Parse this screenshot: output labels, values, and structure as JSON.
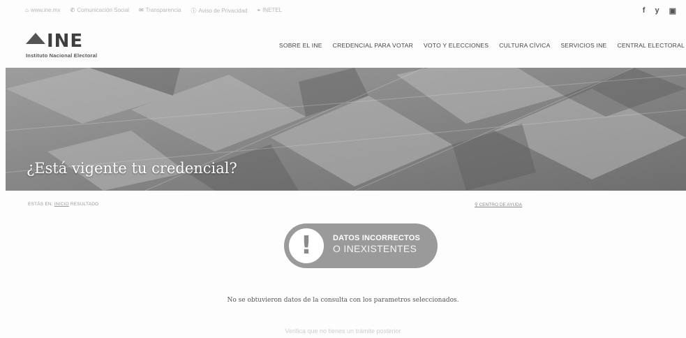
{
  "topbar": {
    "items": [
      {
        "icon": "home-icon",
        "label": "www.ine.mx"
      },
      {
        "icon": "phone-icon",
        "label": "Comunicación Social"
      },
      {
        "icon": "mail-icon",
        "label": "Transparencia"
      },
      {
        "icon": "info-icon",
        "label": "Aviso de Privacidad"
      },
      {
        "icon": "map-icon",
        "label": "INETEL"
      }
    ],
    "social": [
      {
        "icon": "facebook-icon",
        "glyph": "f"
      },
      {
        "icon": "twitter-icon",
        "glyph": "y"
      },
      {
        "icon": "youtube-icon",
        "glyph": "▫"
      }
    ]
  },
  "logo": {
    "mark": "INE",
    "subtitle": "Instituto Nacional Electoral"
  },
  "nav": [
    "SOBRE EL INE",
    "CREDENCIAL PARA VOTAR",
    "VOTO Y ELECCIONES",
    "CULTURA CÍVICA",
    "SERVICIOS INE",
    "CENTRAL ELECTORAL"
  ],
  "hero": {
    "title": "¿Está vigente tu credencial?"
  },
  "breadcrumb": {
    "items": [
      "ESTÁS EN:",
      "INICIO",
      "RESULTADO"
    ]
  },
  "help_link": "CENTRO DE AYUDA",
  "alert": {
    "line1": "DATOS INCORRECTOS",
    "line2": "O INEXISTENTES",
    "icon": "exclamation-icon"
  },
  "message": "No se obtuvieron datos de la consulta con los parametros seleccionados.",
  "submessage": "Verifica que no tienes un trámite posterior",
  "colors": {
    "banner": "#8a8a8a",
    "alert_pill": "#9a9a9a",
    "text": "#444444"
  }
}
